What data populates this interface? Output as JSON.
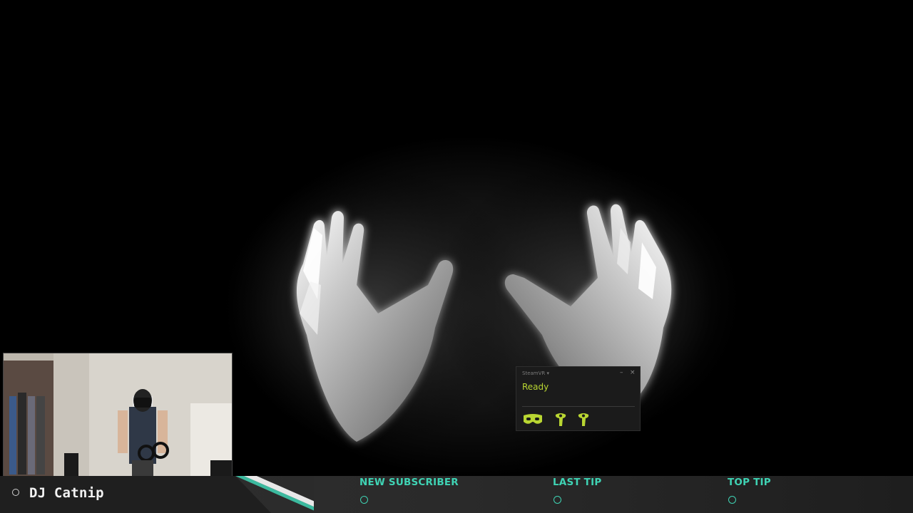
{
  "overlay": {
    "streamer_name": "DJ Catnip",
    "stats": [
      {
        "label": "NEW SUBSCRIBER",
        "value": ""
      },
      {
        "label": "LAST TIP",
        "value": ""
      },
      {
        "label": "TOP TIP",
        "value": ""
      }
    ],
    "accent_color": "#3fd3b4"
  },
  "steamvr_window": {
    "title": "SteamVR ▾",
    "minimize_glyph": "–",
    "close_glyph": "×",
    "status": "Ready",
    "status_color": "#b9d632",
    "devices": [
      "headset-icon",
      "controller-left-icon",
      "controller-right-icon"
    ]
  },
  "scene": {
    "content": "glowing-hands"
  }
}
